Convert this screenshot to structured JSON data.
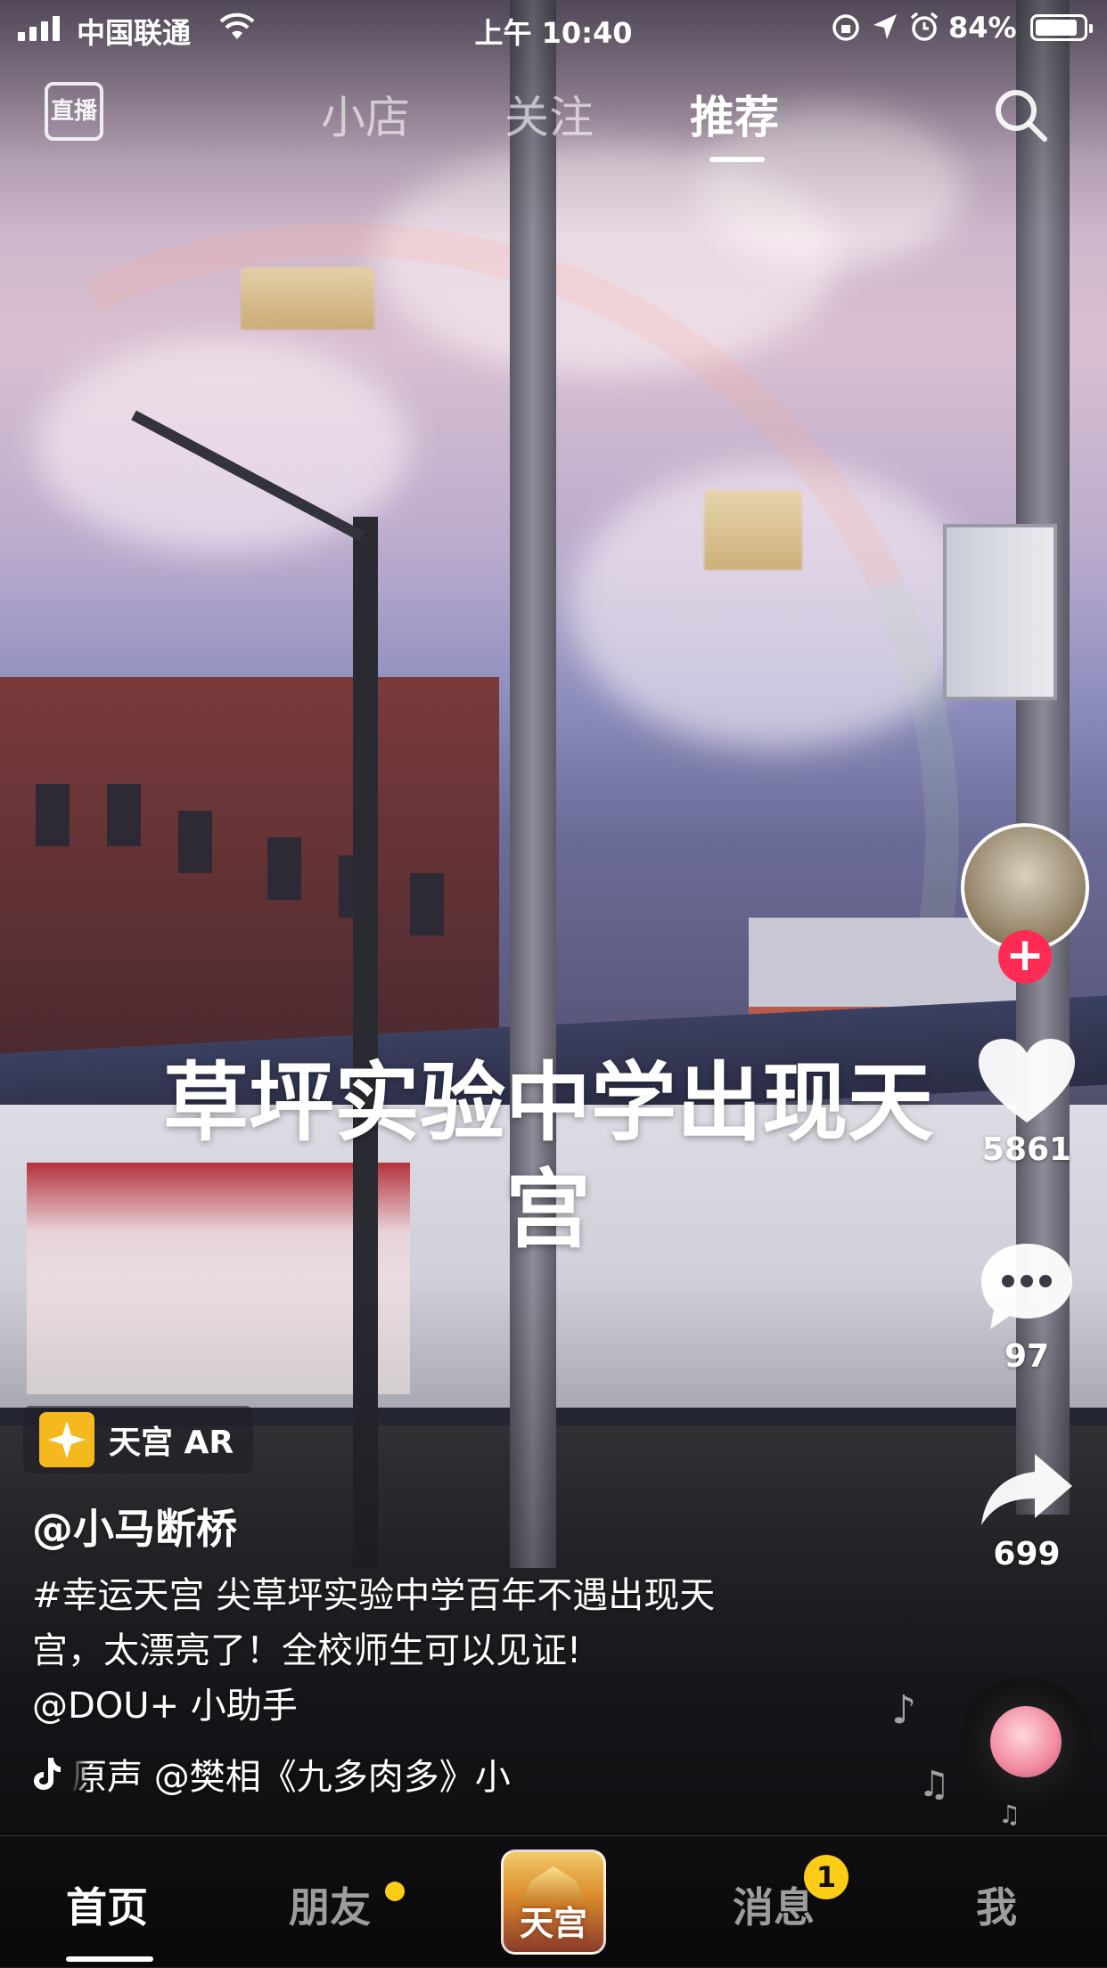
{
  "status_bar": {
    "carrier": "中国联通",
    "time": "上午 10:40",
    "battery_percent": "84%",
    "battery_level": 0.84
  },
  "top_nav": {
    "live_label": "直播",
    "tabs": [
      {
        "label": "小店",
        "active": false
      },
      {
        "label": "关注",
        "active": false
      },
      {
        "label": "推荐",
        "active": true
      }
    ],
    "search_icon": "search-icon"
  },
  "video": {
    "overlay_title_line1": "草坪实验中学出现天",
    "overlay_title_line2": "宫",
    "effect_tag": "天宫 AR",
    "author": "@小马断桥",
    "description_line1": "#幸运天宫 尖草坪实验中学百年不遇出现天",
    "description_line2": "宫，太漂亮了！全校师生可以见证!",
    "description_line3": "@DOU+ 小助手",
    "music": "原声   @樊相《九多肉多》小"
  },
  "actions": {
    "likes": "5861",
    "comments": "97",
    "shares": "699"
  },
  "tab_bar": {
    "tabs": [
      {
        "label": "首页",
        "active": true
      },
      {
        "label": "朋友",
        "active": false
      },
      {
        "label": "消息",
        "active": false
      },
      {
        "label": "我",
        "active": false
      }
    ],
    "center_label": "天宫",
    "message_badge": "1"
  },
  "colors": {
    "accent_red": "#fe2c55",
    "badge_yellow": "#fccc17"
  }
}
